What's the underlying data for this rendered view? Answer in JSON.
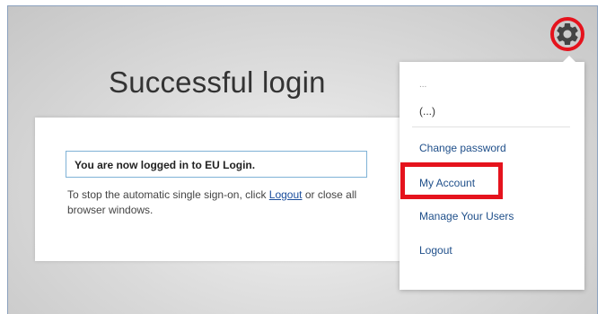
{
  "page": {
    "title": "Successful login"
  },
  "card": {
    "notice": "You are now logged in to EU Login.",
    "info_before": "To stop the automatic single sign-on, click ",
    "logout_link": "Logout",
    "info_after": " or close all browser windows."
  },
  "settings": {
    "icon": "gear-icon"
  },
  "menu": {
    "dots": "...",
    "user": "(...)",
    "items": [
      {
        "label": "Change password"
      },
      {
        "label": "My Account"
      },
      {
        "label": "Manage Your Users"
      },
      {
        "label": "Logout"
      }
    ]
  },
  "colors": {
    "highlight_red": "#e5131d",
    "link_blue": "#1f4f8a",
    "notice_border": "#7fb2d6"
  }
}
